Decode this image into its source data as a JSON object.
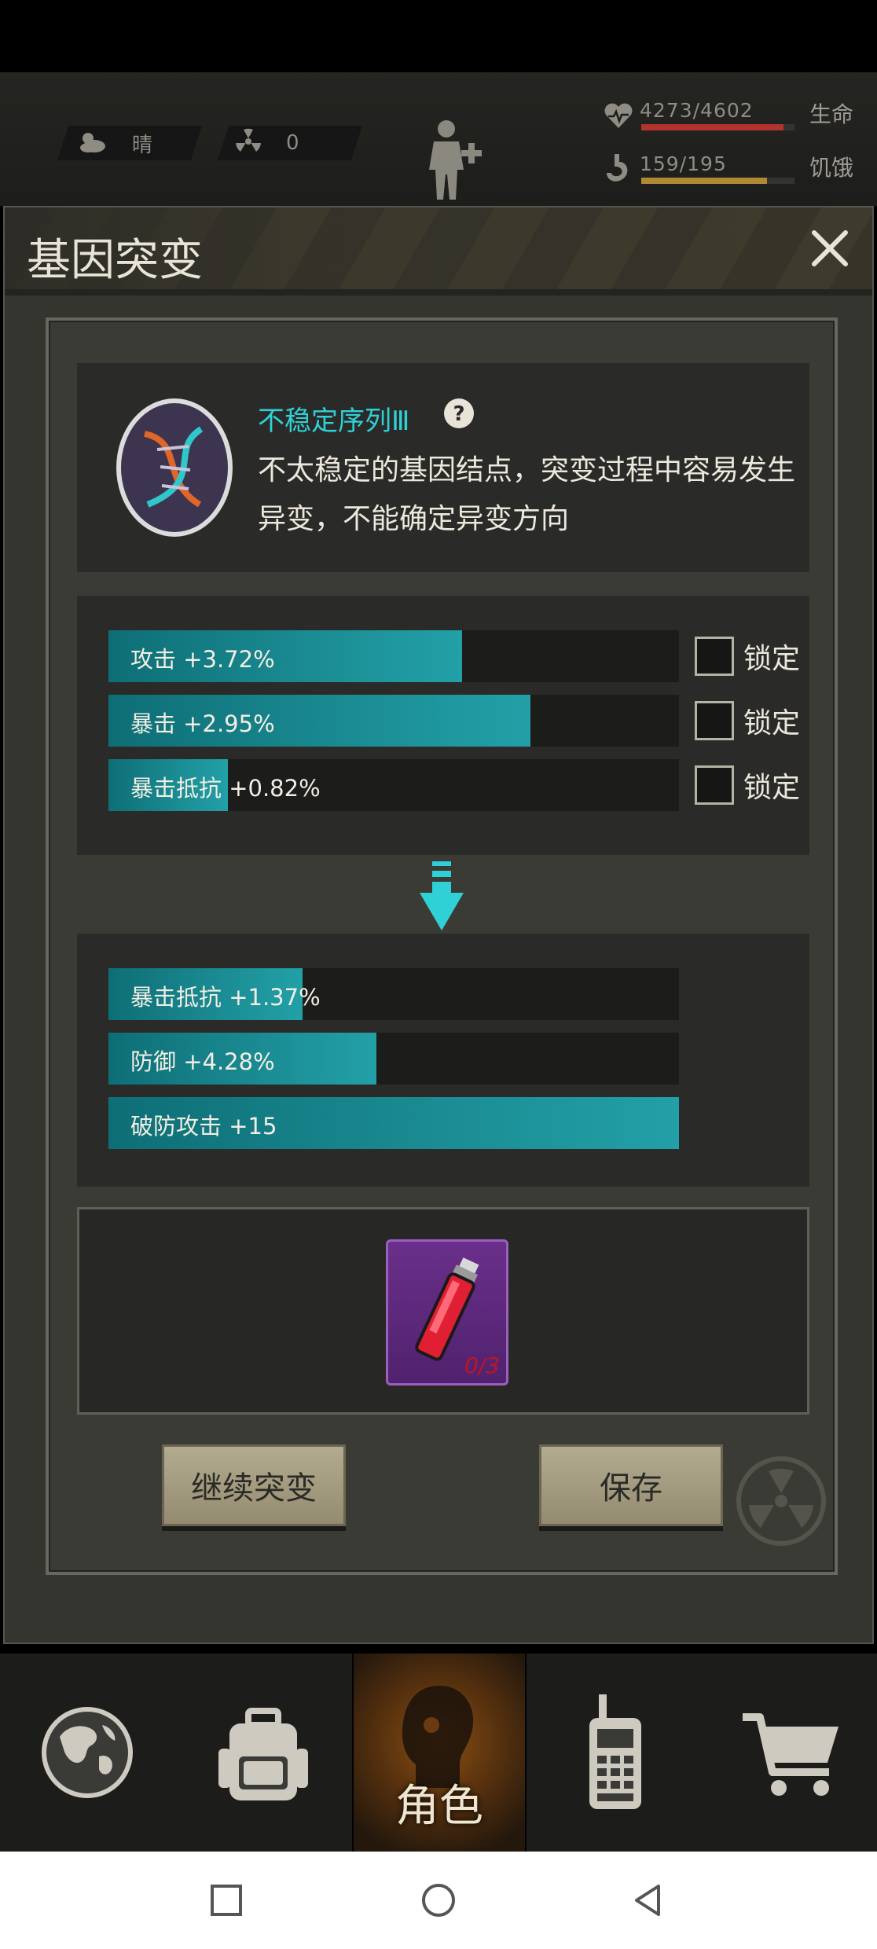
{
  "hud": {
    "weather": "晴",
    "radiation": "0",
    "health": {
      "value": "4273/4602",
      "label": "生命",
      "fraction": 0.93,
      "color": "#b2342c"
    },
    "hunger": {
      "value": "159/195",
      "label": "饥饿",
      "fraction": 0.82,
      "color": "#b08a33"
    }
  },
  "dialog": {
    "title": "基因突变",
    "gene": {
      "name": "不稳定序列Ⅲ",
      "description": "不太稳定的基因结点，突变过程中容易发生异变，不能确定异变方向"
    },
    "current_attributes": [
      {
        "text": "攻击 +3.72%",
        "fill": 0.62,
        "lock_label": "锁定"
      },
      {
        "text": "暴击 +2.95%",
        "fill": 0.74,
        "lock_label": "锁定"
      },
      {
        "text": "暴击抵抗 +0.82%",
        "fill": 0.21,
        "lock_label": "锁定"
      }
    ],
    "new_attributes": [
      {
        "text": "暴击抵抗 +1.37%",
        "fill": 0.34
      },
      {
        "text": "防御 +4.28%",
        "fill": 0.47
      },
      {
        "text": "破防攻击 +15",
        "fill": 1.0
      }
    ],
    "item": {
      "count": "0/3",
      "icon": "red-vial-icon"
    },
    "buttons": {
      "continue": "继续突变",
      "save": "保存"
    }
  },
  "nav": {
    "items": [
      {
        "name": "globe-icon"
      },
      {
        "name": "backpack-icon"
      },
      {
        "name": "character-icon",
        "label": "角色",
        "active": true
      },
      {
        "name": "walkie-talkie-icon"
      },
      {
        "name": "cart-icon"
      }
    ]
  },
  "colors": {
    "accent_cyan": "#2fd1d6",
    "bar_teal": "#1b8d94",
    "item_purple": "#6a2f8a"
  }
}
